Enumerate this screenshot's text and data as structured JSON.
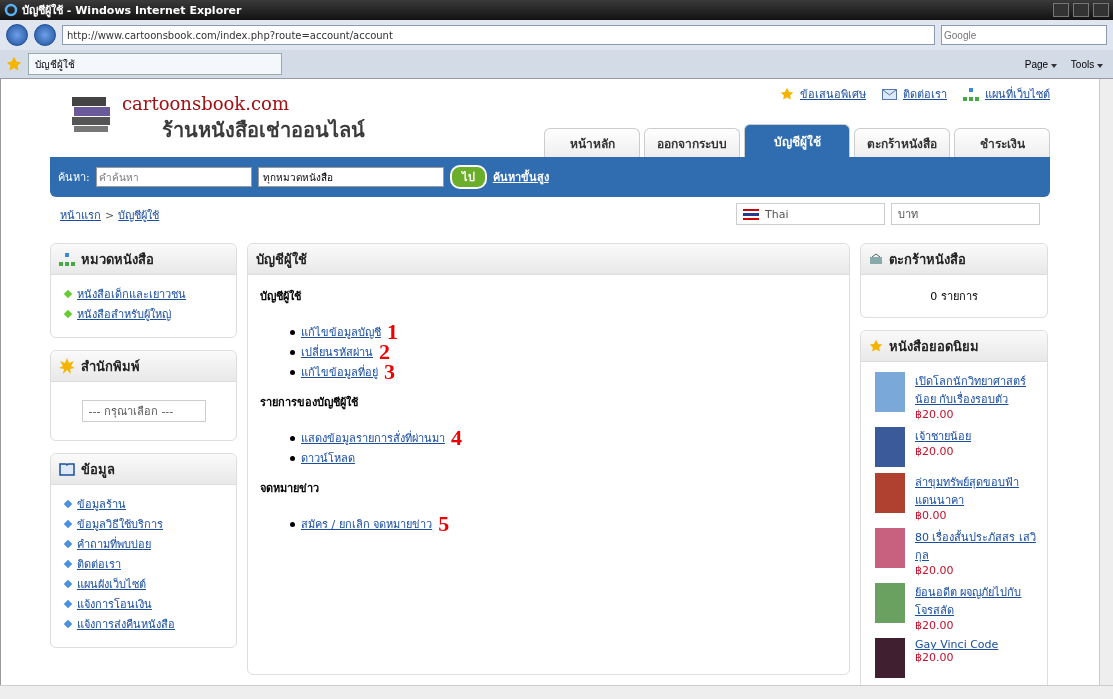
{
  "window": {
    "title": "บัญชีผู้ใช้ - Windows Internet Explorer"
  },
  "browser": {
    "url": "http://www.cartoonsbook.com/index.php?route=account/account",
    "search_placeholder": "Google",
    "tab_title": "บัญชีผู้ใช้",
    "toolbar": [
      "Page",
      "Tools"
    ]
  },
  "header": {
    "top_links": [
      {
        "kind": "star",
        "label": "ข้อเสนอพิเศษ"
      },
      {
        "kind": "mail",
        "label": "ติดต่อเรา"
      },
      {
        "kind": "sitemap",
        "label": "แผนที่เว็บไซต์"
      }
    ],
    "logo_title": "cartoonsbook.com",
    "logo_subtitle": "ร้านหนังสือเช่าออนไลน์",
    "nav_tabs": [
      {
        "label": "หน้าหลัก",
        "selected": false
      },
      {
        "label": "ออกจากระบบ",
        "selected": false
      },
      {
        "label": "บัญชีผู้ใช้",
        "selected": true
      },
      {
        "label": "ตะกร้าหนังสือ",
        "selected": false
      },
      {
        "label": "ชำระเงิน",
        "selected": false
      }
    ]
  },
  "search_bar": {
    "label": "ค้นหา:",
    "placeholder": "คำค้นหา",
    "category": "ทุกหมวดหนังสือ",
    "button": "ไป",
    "advanced_link": "ค้นหาขั้นสูง"
  },
  "breadcrumb": {
    "items": [
      "หน้าแรก",
      "บัญชีผู้ใช้"
    ],
    "separator": ">"
  },
  "language": "Thai",
  "currency": "บาท",
  "left_sidebar": [
    {
      "kind": "links",
      "title": "หมวดหนังสือ",
      "items": [
        "หนังสือเด็กและเยาวชน",
        "หนังสือสำหรับผู้ใหญ่"
      ]
    },
    {
      "kind": "select",
      "title": "สำนักพิมพ์",
      "select": "--- กรุณาเลือก ---"
    },
    {
      "kind": "links",
      "title": "ข้อมูล",
      "items": [
        "ข้อมูลร้าน",
        "ข้อมูลวิธีใช้บริการ",
        "คำถามที่พบบ่อย",
        "ติดต่อเรา",
        "แผนผังเว็บไซต์",
        "แจ้งการโอนเงิน",
        "แจ้งการส่งคืนหนังสือ"
      ]
    }
  ],
  "content": {
    "title": "บัญชีผู้ใช้",
    "sections": [
      {
        "heading": "บัญชีผู้ใช้",
        "links": [
          {
            "label": "แก้ไขข้อมูลบัญชี",
            "annotation": "1"
          },
          {
            "label": "เปลี่ยนรหัสผ่าน",
            "annotation": "2"
          },
          {
            "label": "แก้ไขข้อมูลที่อยู่",
            "annotation": "3"
          }
        ]
      },
      {
        "heading": "รายการของบัญชีผู้ใช้",
        "links": [
          {
            "label": "แสดงข้อมูลรายการสั่งที่ผ่านมา",
            "annotation": "4"
          },
          {
            "label": "ดาวน์โหลด"
          }
        ]
      },
      {
        "heading": "จดหมายข่าว",
        "links": [
          {
            "label": "สมัคร / ยกเลิก จดหมายข่าว",
            "annotation": "5"
          }
        ]
      }
    ]
  },
  "cart": {
    "title": "ตะกร้าหนังสือ",
    "summary": "0 รายการ"
  },
  "bestsellers": {
    "title": "หนังสือยอดนิยม",
    "books": [
      {
        "title": "เปิดโลกนักวิทยาศาสตร์น้อย กับเรื่องรอบตัว",
        "price": "฿20.00"
      },
      {
        "title": "เจ้าชายน้อย",
        "price": "฿20.00"
      },
      {
        "title": "ล่าขุมทรัพย์สุดขอบฟ้าแดนนาคา",
        "price": "฿0.00"
      },
      {
        "title": "80 เรื่องสั้นประภัสสร เสวิกุล",
        "price": "฿20.00"
      },
      {
        "title": "ย้อนอดีต ผจญภัยไปกับโจรสลัด",
        "price": "฿20.00"
      },
      {
        "title": "Gay Vinci Code",
        "price": "฿20.00"
      }
    ]
  }
}
